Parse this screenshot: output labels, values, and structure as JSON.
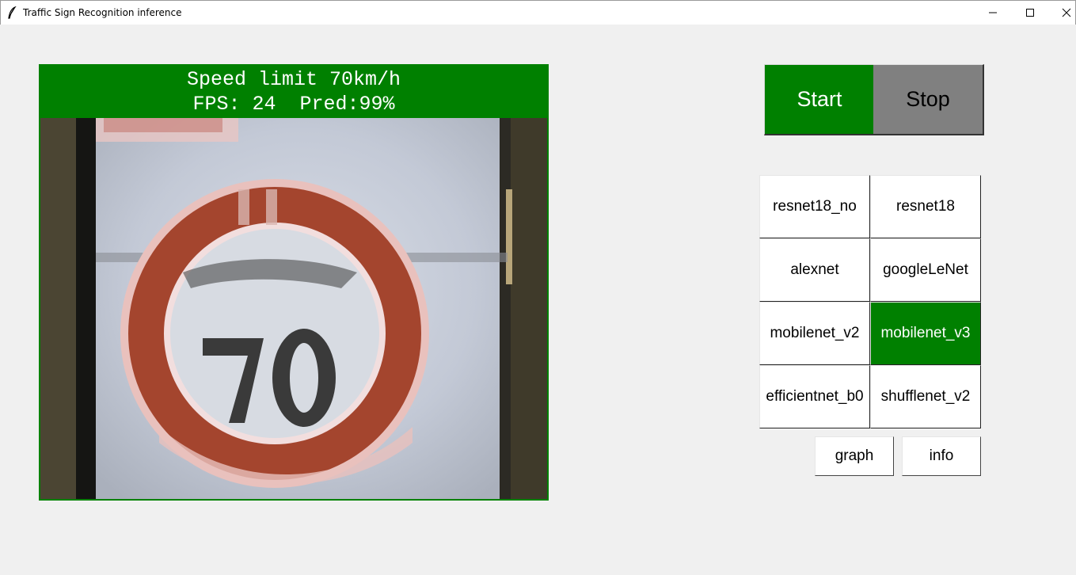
{
  "window": {
    "title": "Traffic Sign Recognition inference",
    "app_icon": "feather-icon"
  },
  "viewer": {
    "prediction_label": "Speed limit 70km/h",
    "stats_line": "FPS: 24  Pred:99%",
    "fps": 24,
    "confidence_percent": 99,
    "frame_content": "camera frame showing 70 speed limit sign",
    "sign_text": "70",
    "accent_color": "#008000"
  },
  "controls": {
    "start_label": "Start",
    "stop_label": "Stop"
  },
  "models": [
    {
      "label": "resnet18_no",
      "active": false
    },
    {
      "label": "resnet18",
      "active": false
    },
    {
      "label": "alexnet",
      "active": false
    },
    {
      "label": "googleLeNet",
      "active": false
    },
    {
      "label": "mobilenet_v2",
      "active": false
    },
    {
      "label": "mobilenet_v3",
      "active": true
    },
    {
      "label": "efficientnet_b0",
      "active": false
    },
    {
      "label": "shufflenet_v2",
      "active": false
    }
  ],
  "extra": {
    "graph_label": "graph",
    "info_label": "info"
  }
}
